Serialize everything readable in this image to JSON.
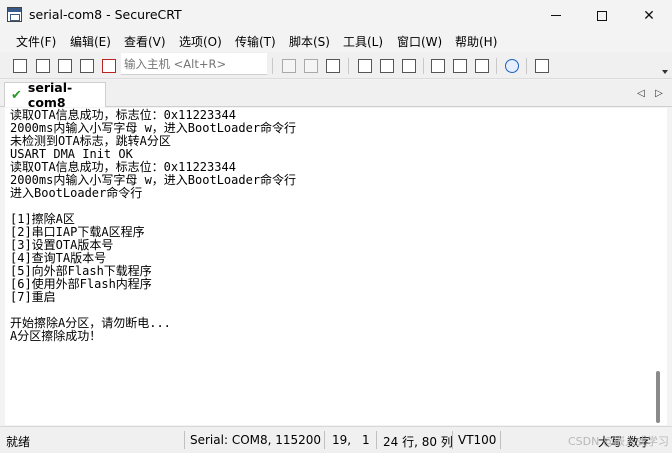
{
  "window": {
    "title": "serial-com8 - SecureCRT"
  },
  "menubar": {
    "items": [
      "文件(F)",
      "编辑(E)",
      "查看(V)",
      "选项(O)",
      "传输(T)",
      "脚本(S)",
      "工具(L)",
      "窗口(W)",
      "帮助(H)"
    ]
  },
  "toolbar": {
    "host_placeholder": "输入主机 <Alt+R>",
    "icons": [
      "connect-icon",
      "quick-connect-icon",
      "connect-in-tab-icon",
      "reconnect-icon",
      "disconnect-icon",
      "copy-icon",
      "paste-icon",
      "find-icon",
      "print-setup-icon",
      "print-icon",
      "print-selection-icon",
      "session-options-icon",
      "global-options-icon",
      "keymap-icon",
      "help-icon",
      "sftp-icon"
    ]
  },
  "tabs": [
    {
      "label": "serial-com8",
      "active": true,
      "connected": true
    }
  ],
  "terminal": {
    "lines": [
      "读取OTA信息成功，标志位：0x11223344",
      "2000ms内输入小写字母 w，进入BootLoader命令行",
      "未检测到OTA标志，跳转A分区",
      "USART DMA Init OK",
      "读取OTA信息成功，标志位：0x11223344",
      "2000ms内输入小写字母 w，进入BootLoader命令行",
      "进入BootLoader命令行",
      "",
      "[1]擦除A区",
      "[2]串口IAP下载A区程序",
      "[3]设置OTA版本号",
      "[4]查询TA版本号",
      "[5]向外部Flash下载程序",
      "[6]使用外部Flash内程序",
      "[7]重启",
      "",
      "开始擦除A分区，请勿断电...",
      "A分区擦除成功！"
    ]
  },
  "statusbar": {
    "ready": "就绪",
    "serial": "Serial: COM8, 115200",
    "row": "19,",
    "col": "1",
    "size": "24 行, 80 列",
    "emulation": "VT100",
    "caps": "大写",
    "num": "数字"
  },
  "watermark": "CSDN @嵌入式学习"
}
